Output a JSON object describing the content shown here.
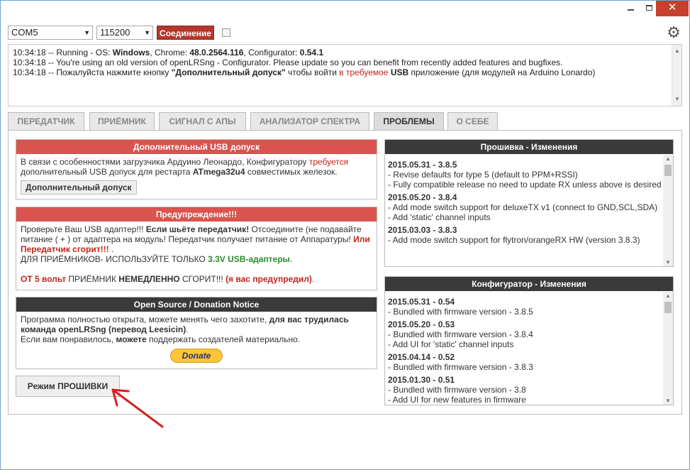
{
  "window": {
    "close_glyph": "✕"
  },
  "toolbar": {
    "port": "COM5",
    "baud": "115200",
    "connect_label": "Соединение"
  },
  "log": {
    "lines": [
      "10:34:18 -- Running - OS: ",
      "Windows",
      ", Chrome: ",
      "48.0.2564.116",
      ", Configurator: ",
      "0.54.1",
      "10:34:18 -- You're using an old version of openLRSng - Configurator. Please update so you can benefit from recently added features and bugfixes.",
      "10:34:18 -- Пожалуйста нажмите кнопку ",
      "\"Дополнительный допуск\"",
      " чтобы войти ",
      "в требуемое",
      " ",
      "USB",
      " приложение (для модулей на Arduino Lonardo)"
    ]
  },
  "tabs": [
    {
      "label": "ПЕРЕДАТЧИК"
    },
    {
      "label": "ПРИЁМНИК"
    },
    {
      "label": "СИГНАЛ С АПЫ"
    },
    {
      "label": "АНАЛИЗАТОР СПЕКТРА"
    },
    {
      "label": "ПРОБЛЕМЫ"
    },
    {
      "label": "О СЕБЕ"
    }
  ],
  "usb_panel": {
    "title": "Дополнительный USB допуск",
    "text_1": "В связи с особенностями загрузчика Ардуино Леонардо, Конфигуратору ",
    "text_red": "требуется",
    "text_2": "дополнительный USB допуск для рестарта ",
    "text_bold": "ATmega32u4",
    "text_3": " совместимых железок.",
    "button": "Дополнительный допуск"
  },
  "warning_panel": {
    "title": "Предупреждение!!!",
    "p1a": "Проверьте Ваш USB адаптер!!! ",
    "p1b": "Если шьёте передатчик!",
    "p1c": " Отсоедините (не подавайте",
    "p2": "питание ( + ) от адаптера на модуль! Передатчик получает питание от Аппаратуры! ",
    "p2red": "Или",
    "p3red": "Передатчик сгорит!!!",
    "p3": " .",
    "p4a": "ДЛЯ ПРИЁМНИКОВ- ИСПОЛЬЗУЙТЕ ТОЛЬКО ",
    "p4green": "3.3V USB-адаптеры",
    "p4b": ".",
    "p5red": "ОТ 5 вольт",
    "p5a": " ПРИЁМНИК ",
    "p5bold": "НЕМЕДЛЕННО",
    "p5b": " СГОРИТ!!! ",
    "p5red2": "(я вас предупредил)",
    "p5c": "."
  },
  "donation_panel": {
    "title": "Open Source / Donation Notice",
    "l1a": "Программа полностью открыта, можете менять чего захотите, ",
    "l1b": "для вас трудилась",
    "l2": "команда openLRSng (перевод Leesicin)",
    "l2b": ".",
    "l3a": "Если вам понравилось, ",
    "l3b": "можете",
    "l3c": " поддержать создателей материально.",
    "donate": "Donate"
  },
  "flash_button": "Режим ПРОШИВКИ",
  "firmware_changes": {
    "title": "Прошивка - Изменения",
    "entries": [
      {
        "version": "2015.05.31 - 3.8.5",
        "lines": [
          "- Revise defaults for type 5 (default to PPM+RSSI)",
          "- Fully compatible release no need to update RX unless above is desired"
        ]
      },
      {
        "version": "2015.05.20 - 3.8.4",
        "lines": [
          "- Add mode switch support for deluxeTX v1 (connect to GND,SCL,SDA)",
          "- Add 'static' channel inputs"
        ]
      },
      {
        "version": "2015.03.03 - 3.8.3",
        "lines": [
          "- Add mode switch support for flytron/orangeRX HW (version 3.8.3)"
        ]
      }
    ]
  },
  "configurator_changes": {
    "title": "Конфигуратор - Изменения",
    "entries": [
      {
        "version": "2015.05.31 - 0.54",
        "lines": [
          "- Bundled with firmware version - 3.8.5"
        ]
      },
      {
        "version": "2015.05.20 - 0.53",
        "lines": [
          "- Bundled with firmware version - 3.8.4",
          "- Add UI for 'static' channel inputs"
        ]
      },
      {
        "version": "2015.04.14 - 0.52",
        "lines": [
          "- Bundled with firmware version - 3.8.3"
        ]
      },
      {
        "version": "2015.01.30 - 0.51",
        "lines": [
          "- Bundled with firmware version - 3.8",
          "- Add UI for new features in firmware"
        ]
      }
    ]
  }
}
